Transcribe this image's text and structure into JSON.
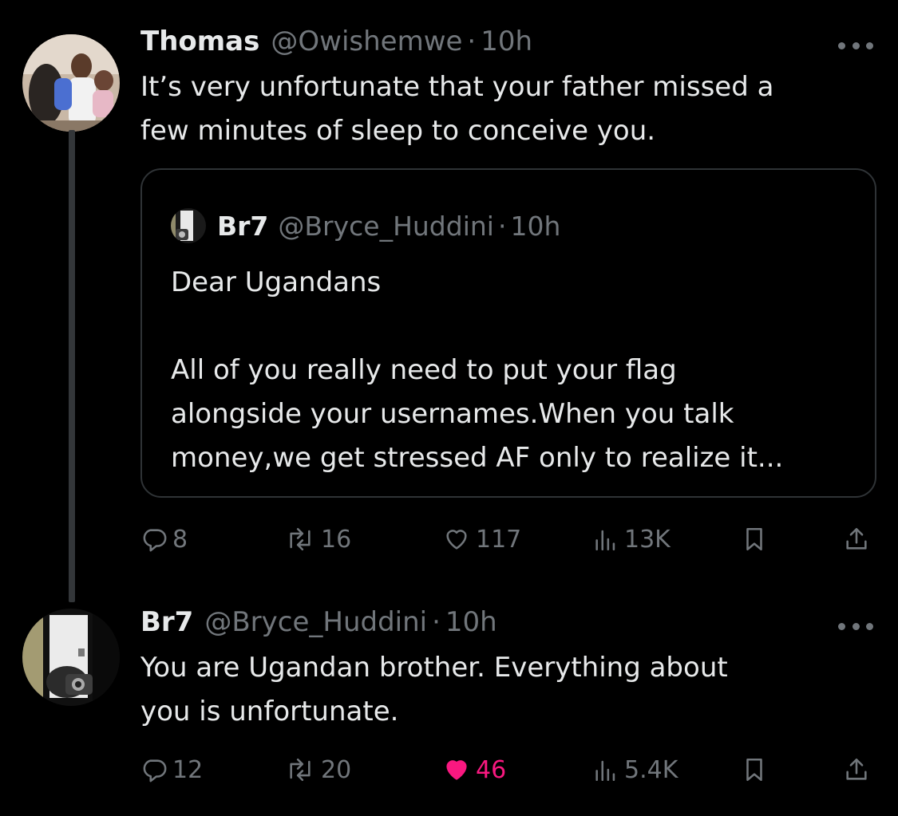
{
  "thread": {
    "tweet1": {
      "name": "Thomas",
      "handle": "@Owishemwe",
      "separator": "·",
      "time": "10h",
      "text": "It’s very unfortunate that your father missed a\nfew minutes of sleep to conceive you.",
      "quote": {
        "name": "Br7",
        "handle": "@Bryce_Huddini",
        "separator": "·",
        "time": "10h",
        "text": "Dear Ugandans\n\nAll of you really need to put your flag\nalongside your usernames.When you talk\nmoney,we get stressed AF only to realize it..."
      },
      "actions": {
        "replies": "8",
        "reposts": "16",
        "likes": "117",
        "views": "13K"
      }
    },
    "tweet2": {
      "name": "Br7",
      "handle": "@Bryce_Huddini",
      "separator": "·",
      "time": "10h",
      "text": "You are Ugandan brother. Everything about\nyou is unfortunate.",
      "actions": {
        "replies": "12",
        "reposts": "20",
        "likes": "46",
        "views": "5.4K"
      }
    }
  },
  "colors": {
    "background": "#000000",
    "text_primary": "#e7e9ea",
    "text_secondary": "#71767b",
    "like_active": "#f91880",
    "border": "#2f3336"
  },
  "icons": [
    "more-icon",
    "reply-icon",
    "repost-icon",
    "like-icon",
    "views-icon",
    "bookmark-icon",
    "share-icon"
  ]
}
